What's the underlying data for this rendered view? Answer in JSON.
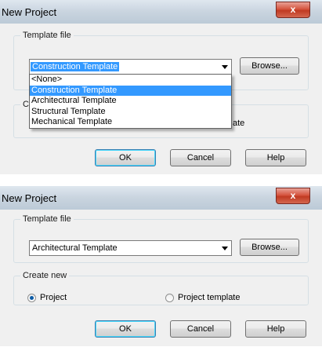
{
  "top_dialog": {
    "title": "New Project",
    "close_glyph": "x",
    "template_group_label": "Template file",
    "selected_template": "Construction Template",
    "browse_label": "Browse...",
    "dropdown_options": [
      "<None>",
      "Construction Template",
      "Architectural Template",
      "Structural Template",
      "Mechanical Template"
    ],
    "highlighted_option": "Construction Template",
    "obscured_group_letter": "C",
    "obscured_radio_fragment": "ate",
    "ok_label": "OK",
    "cancel_label": "Cancel",
    "help_label": "Help"
  },
  "bottom_dialog": {
    "title": "New Project",
    "close_glyph": "x",
    "template_group_label": "Template file",
    "selected_template": "Architectural Template",
    "browse_label": "Browse...",
    "create_group_label": "Create new",
    "radio_project": "Project",
    "radio_project_template": "Project template",
    "selected_create": "Project",
    "ok_label": "OK",
    "cancel_label": "Cancel",
    "help_label": "Help"
  },
  "colors": {
    "selection": "#3399ff",
    "close_button": "#c03a22",
    "dialog_bg": "#f0f0f0"
  },
  "icons": {
    "close": "close-icon",
    "dropdown_arrow": "chevron-down-icon",
    "radio": "radio-icon"
  }
}
